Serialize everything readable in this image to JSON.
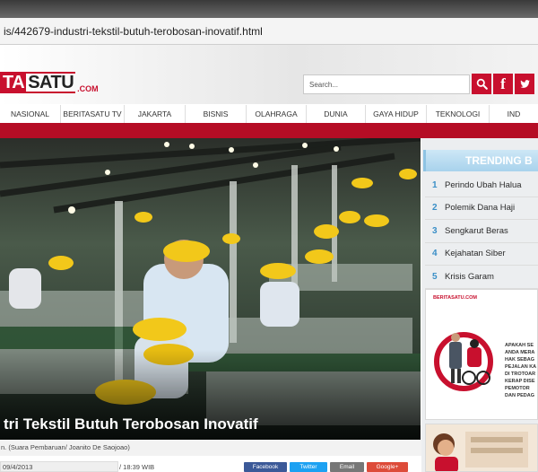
{
  "browser": {
    "url": "is/442679-industri-tekstil-butuh-terobosan-inovatif.html"
  },
  "header": {
    "logo_red": "TA",
    "logo_dark": "SATU",
    "logo_suffix": ".COM",
    "search_placeholder": "Search...",
    "icons": [
      "search-icon",
      "facebook-icon",
      "twitter-icon"
    ],
    "brand_color": "#c8102e"
  },
  "nav": {
    "items": [
      "NASIONAL",
      "BERITASATU TV",
      "JAKARTA",
      "BISNIS",
      "OLAHRAGA",
      "DUNIA",
      "GAYA HIDUP",
      "TEKNOLOGI",
      "IND"
    ]
  },
  "article": {
    "title": "tri Tekstil Butuh Terobosan Inovatif",
    "caption": "n. (Suara Pembaruan/ Joanito De Saojoao)",
    "date": "09/4/2013",
    "time": "/ 18:39 WIB",
    "share": [
      "Facebook",
      "Twitter",
      "Email",
      "Google+"
    ]
  },
  "sidebar": {
    "trending_title": "TRENDING B",
    "trending": [
      {
        "num": "1",
        "label": "Perindo Ubah Halua"
      },
      {
        "num": "2",
        "label": "Polemik Dana Haji"
      },
      {
        "num": "3",
        "label": "Sengkarut Beras"
      },
      {
        "num": "4",
        "label": "Kejahatan Siber"
      },
      {
        "num": "5",
        "label": "Krisis Garam"
      }
    ],
    "ad_logo": "BERITASATU.COM",
    "ad_text": "APAKAH SE\nANDA MERA\nHAK SEBAG\nPEJALAN KA\nDI TROTOAR\nKERAP DISE\nPEMOTOR\nDAN PEDAG"
  }
}
